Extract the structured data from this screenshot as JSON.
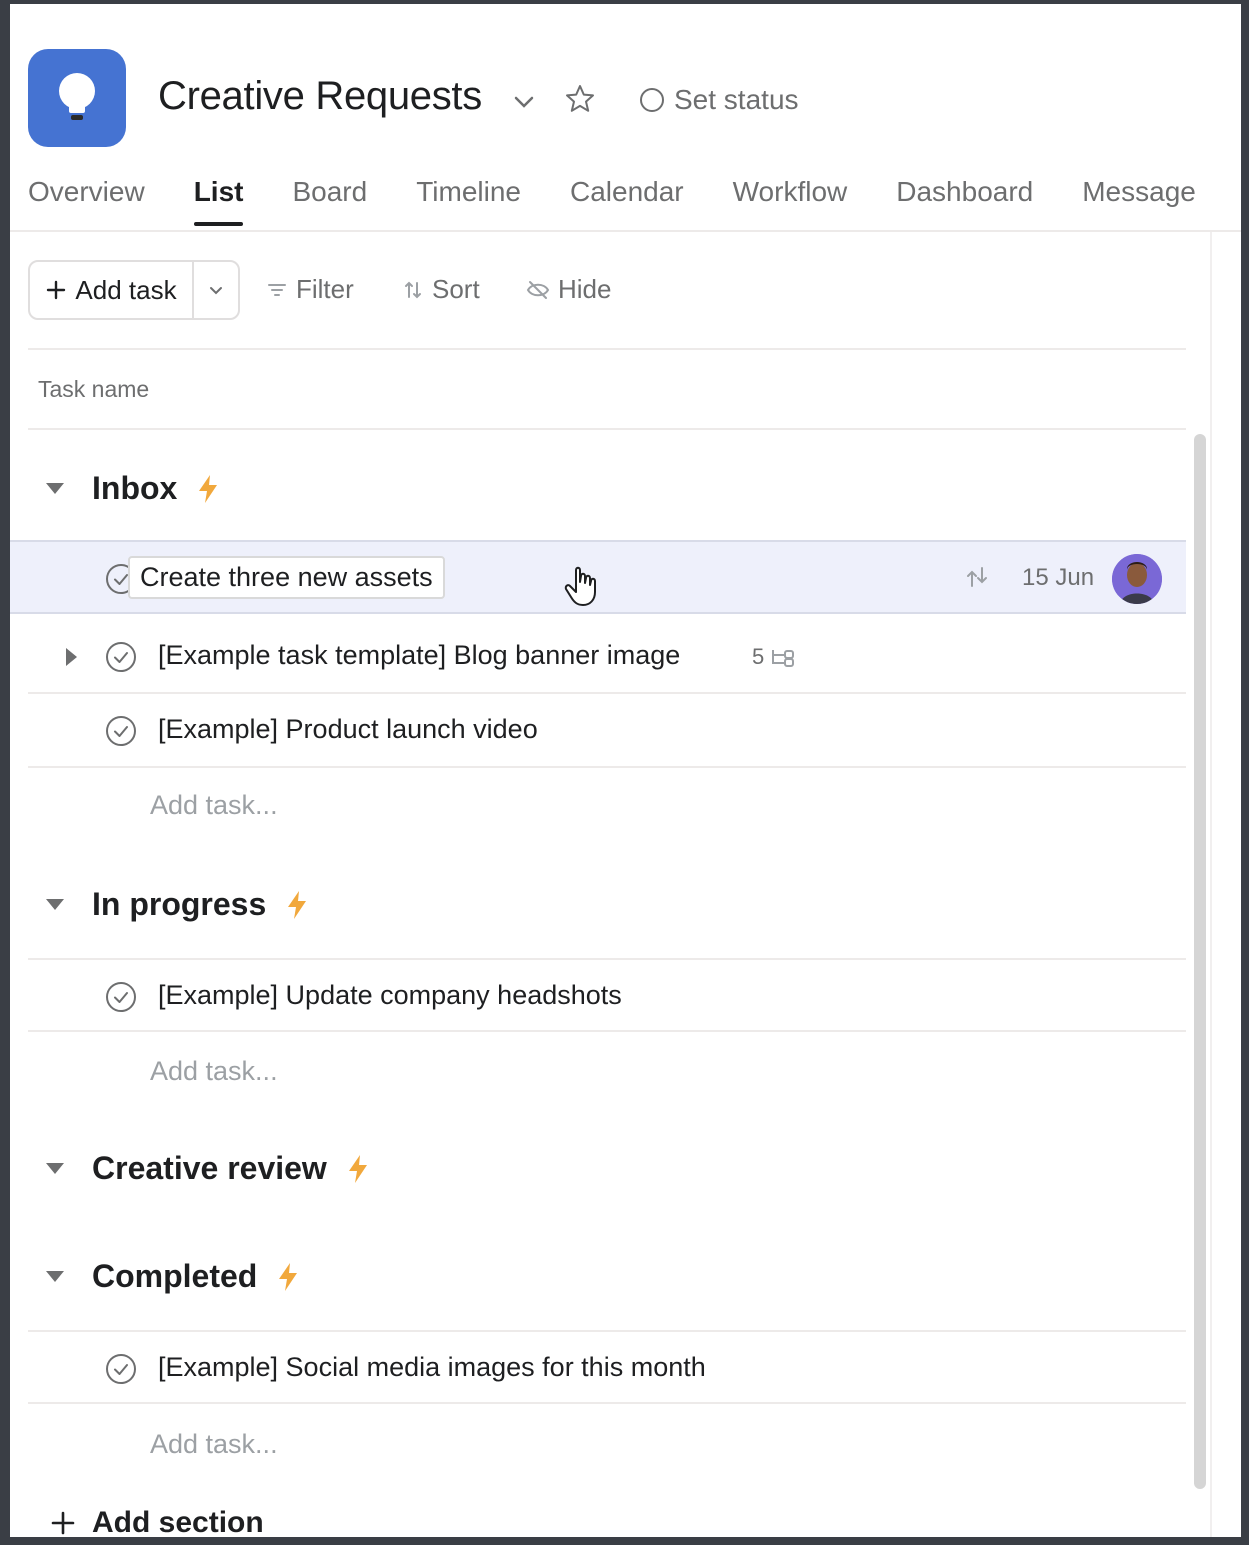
{
  "header": {
    "title": "Creative Requests",
    "set_status": "Set status",
    "accent": "#4573d2"
  },
  "tabs": [
    {
      "label": "Overview"
    },
    {
      "label": "List",
      "active": true
    },
    {
      "label": "Board"
    },
    {
      "label": "Timeline"
    },
    {
      "label": "Calendar"
    },
    {
      "label": "Workflow"
    },
    {
      "label": "Dashboard"
    },
    {
      "label": "Message"
    }
  ],
  "toolbar": {
    "add_task": "Add task",
    "filter": "Filter",
    "sort": "Sort",
    "hide": "Hide"
  },
  "list": {
    "column_header": "Task name",
    "add_task_placeholder": "Add task...",
    "add_section": "Add section",
    "sections": [
      {
        "name": "Inbox",
        "tasks": [
          {
            "name": "Create three new assets",
            "due": "15 Jun",
            "highlighted": true
          },
          {
            "name": "[Example task template] Blog banner image",
            "subtasks": "5"
          },
          {
            "name": "[Example] Product launch video"
          }
        ]
      },
      {
        "name": "In progress",
        "tasks": [
          {
            "name": "[Example] Update company headshots"
          }
        ]
      },
      {
        "name": "Creative review",
        "tasks": []
      },
      {
        "name": "Completed",
        "tasks": [
          {
            "name": "[Example] Social media images for this month"
          }
        ]
      }
    ]
  },
  "colors": {
    "lightning": "#f1a83c",
    "highlight_row": "#eef0fb",
    "text_secondary": "#6d6e6f"
  }
}
